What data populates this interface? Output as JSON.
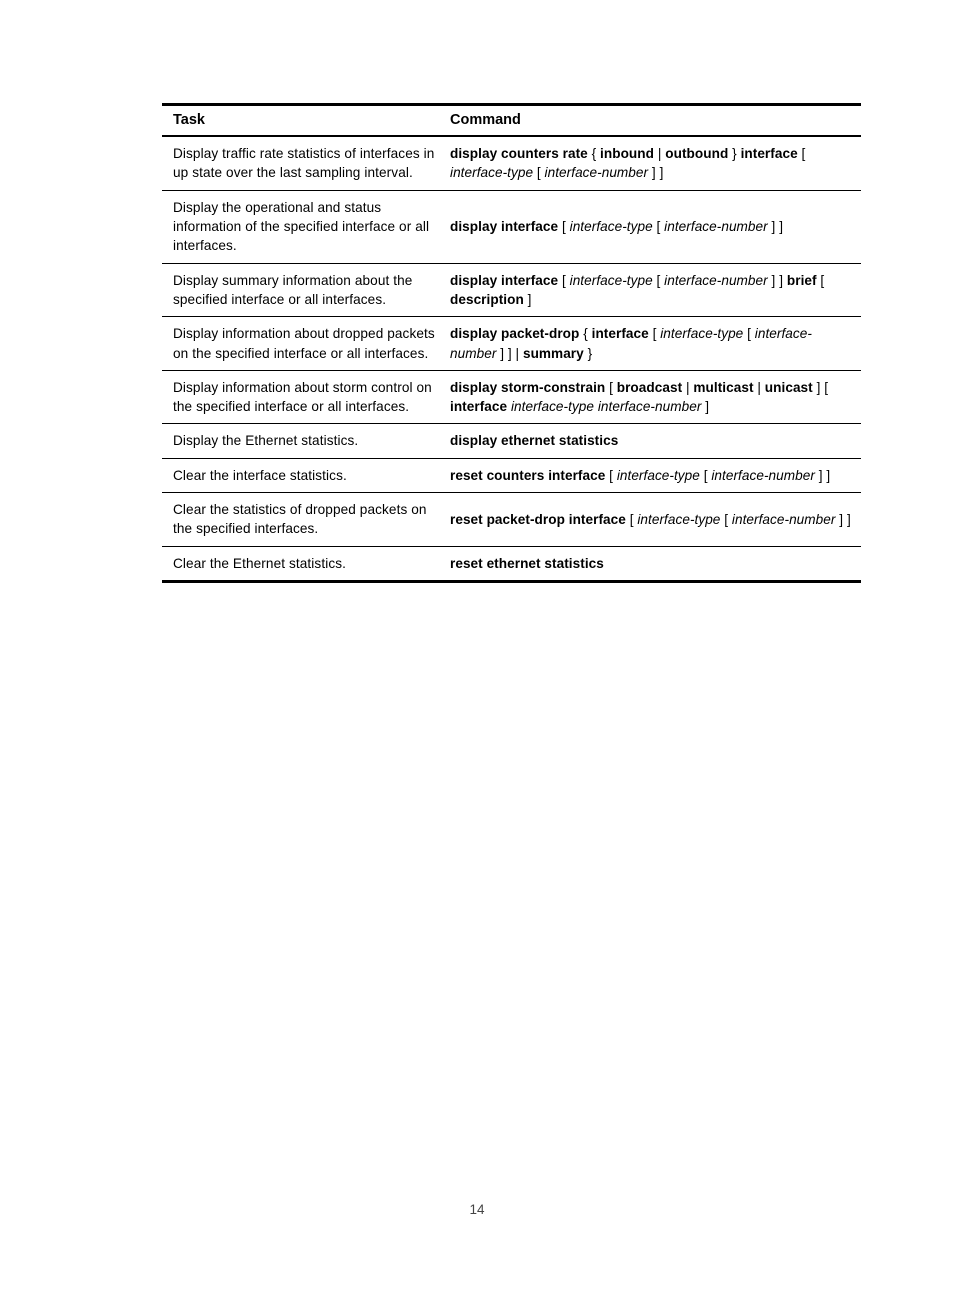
{
  "page": {
    "number": "14"
  },
  "table": {
    "headers": {
      "task": "Task",
      "command": "Command"
    },
    "rows": [
      {
        "task": "Display traffic rate statistics of interfaces in up state over the last sampling interval.",
        "command_text": "display counters rate { inbound | outbound } interface [ interface-type [ interface-number ] ]",
        "command_parts": [
          {
            "t": "display counters rate",
            "s": "kw"
          },
          {
            "t": " { ",
            "s": "punc"
          },
          {
            "t": "inbound",
            "s": "kw"
          },
          {
            "t": " | ",
            "s": "punc"
          },
          {
            "t": "outbound",
            "s": "kw"
          },
          {
            "t": " } ",
            "s": "punc"
          },
          {
            "t": "interface",
            "s": "kw"
          },
          {
            "t": " [ ",
            "s": "punc"
          },
          {
            "t": "interface-type",
            "s": "arg"
          },
          {
            "t": " [ ",
            "s": "punc"
          },
          {
            "t": "interface-number",
            "s": "arg"
          },
          {
            "t": " ] ]",
            "s": "punc"
          }
        ]
      },
      {
        "task": "Display the operational and status information of the specified interface or all interfaces.",
        "command_text": "display interface [ interface-type [ interface-number ] ]",
        "command_parts": [
          {
            "t": "display interface",
            "s": "kw"
          },
          {
            "t": " [ ",
            "s": "punc"
          },
          {
            "t": "interface-type",
            "s": "arg"
          },
          {
            "t": " [ ",
            "s": "punc"
          },
          {
            "t": "interface-number",
            "s": "arg"
          },
          {
            "t": " ] ]",
            "s": "punc"
          }
        ]
      },
      {
        "task": "Display summary information about the specified interface or all interfaces.",
        "command_text": "display interface [ interface-type [ interface-number ] ] brief [ description ]",
        "command_parts": [
          {
            "t": "display interface",
            "s": "kw"
          },
          {
            "t": " [ ",
            "s": "punc"
          },
          {
            "t": "interface-type",
            "s": "arg"
          },
          {
            "t": " [ ",
            "s": "punc"
          },
          {
            "t": "interface-number",
            "s": "arg"
          },
          {
            "t": " ] ] ",
            "s": "punc"
          },
          {
            "t": "brief",
            "s": "kw"
          },
          {
            "t": " [ ",
            "s": "punc"
          },
          {
            "t": "description",
            "s": "kw"
          },
          {
            "t": " ]",
            "s": "punc"
          }
        ]
      },
      {
        "task": "Display information about dropped packets on the specified interface or all interfaces.",
        "command_text": "display packet-drop { interface [ interface-type [ interface-number ] ] | summary }",
        "command_parts": [
          {
            "t": "display packet-drop",
            "s": "kw"
          },
          {
            "t": " { ",
            "s": "punc"
          },
          {
            "t": "interface",
            "s": "kw"
          },
          {
            "t": " [ ",
            "s": "punc"
          },
          {
            "t": "interface-type",
            "s": "arg"
          },
          {
            "t": " [ ",
            "s": "punc"
          },
          {
            "t": "interface-number",
            "s": "arg"
          },
          {
            "t": " ] ] | ",
            "s": "punc"
          },
          {
            "t": "summary",
            "s": "kw"
          },
          {
            "t": " }",
            "s": "punc"
          }
        ]
      },
      {
        "task": "Display information about storm control on the specified interface or all interfaces.",
        "command_text": "display storm-constrain [ broadcast | multicast | unicast ] [ interface interface-type interface-number ]",
        "command_parts": [
          {
            "t": "display storm-constrain",
            "s": "kw"
          },
          {
            "t": " [ ",
            "s": "punc"
          },
          {
            "t": "broadcast",
            "s": "kw"
          },
          {
            "t": " | ",
            "s": "punc"
          },
          {
            "t": "multicast",
            "s": "kw"
          },
          {
            "t": " | ",
            "s": "punc"
          },
          {
            "t": "unicast",
            "s": "kw"
          },
          {
            "t": " ] ",
            "s": "punc"
          },
          {
            "t": "[ ",
            "s": "punc"
          },
          {
            "t": "interface",
            "s": "kw"
          },
          {
            "t": " ",
            "s": "punc"
          },
          {
            "t": "interface-type interface-number",
            "s": "arg"
          },
          {
            "t": " ]",
            "s": "punc"
          }
        ]
      },
      {
        "task": "Display the Ethernet statistics.",
        "command_text": "display ethernet statistics",
        "command_parts": [
          {
            "t": "display ethernet statistics",
            "s": "kw"
          }
        ]
      },
      {
        "task": "Clear the interface statistics.",
        "command_text": "reset counters interface [ interface-type [ interface-number ] ]",
        "command_parts": [
          {
            "t": "reset counters interface",
            "s": "kw"
          },
          {
            "t": " [ ",
            "s": "punc"
          },
          {
            "t": "interface-type",
            "s": "arg"
          },
          {
            "t": " [ ",
            "s": "punc"
          },
          {
            "t": "interface-number",
            "s": "arg"
          },
          {
            "t": " ] ]",
            "s": "punc"
          }
        ]
      },
      {
        "task": "Clear the statistics of dropped packets on the specified interfaces.",
        "command_text": "reset packet-drop interface [ interface-type [ interface-number ] ]",
        "command_parts": [
          {
            "t": "reset packet-drop interface",
            "s": "kw"
          },
          {
            "t": " [ ",
            "s": "punc"
          },
          {
            "t": "interface-type",
            "s": "arg"
          },
          {
            "t": " [ ",
            "s": "punc"
          },
          {
            "t": "interface-number",
            "s": "arg"
          },
          {
            "t": " ] ]",
            "s": "punc"
          }
        ]
      },
      {
        "task": "Clear the Ethernet statistics.",
        "command_text": "reset ethernet statistics",
        "command_parts": [
          {
            "t": "reset ethernet statistics",
            "s": "kw"
          }
        ]
      }
    ]
  }
}
